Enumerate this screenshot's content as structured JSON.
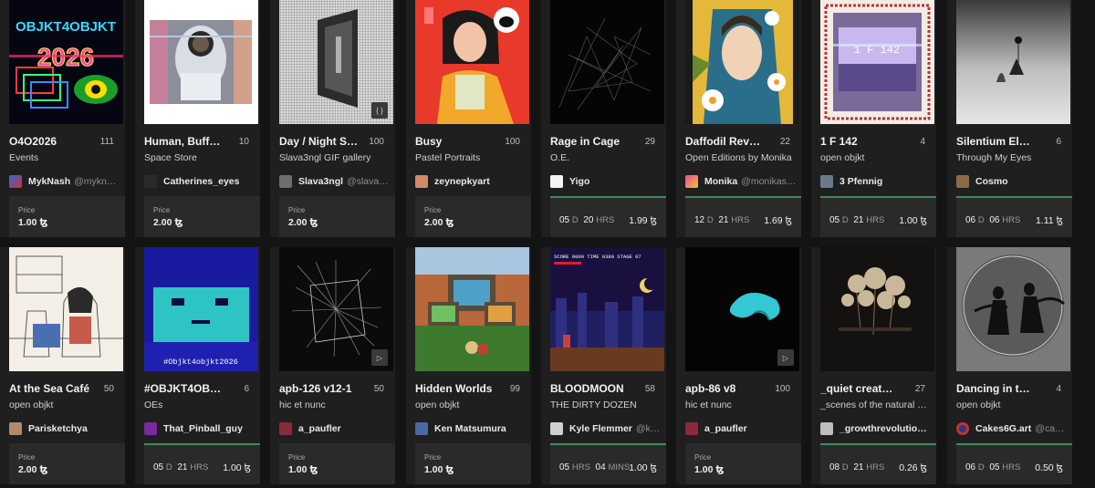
{
  "currency": "ꜩ",
  "price_label": "Price",
  "cards": [
    {
      "title": "O4O2026",
      "count": "111",
      "collection": "Events",
      "artist": "MykNash",
      "handle": "@myknash",
      "price": "1.00 ꜩ"
    },
    {
      "title": "Human, Buff…",
      "count": "10",
      "collection": "Space Store",
      "artist": "Catherines_eyes",
      "handle": "",
      "price": "2.00 ꜩ"
    },
    {
      "title": "Day / Night S…",
      "count": "100",
      "collection": "Slava3ngl GIF gallery",
      "artist": "Slava3ngl",
      "handle": "@slava3…",
      "price": "2.00 ꜩ",
      "thumb_button": "{ }"
    },
    {
      "title": "Busy",
      "count": "100",
      "collection": "Pastel Portraits",
      "artist": "zeynepkyart",
      "handle": "",
      "price": "2.00 ꜩ"
    },
    {
      "title": "Rage in Cage",
      "count": "29",
      "collection": "O.E.",
      "artist": "Yigo",
      "handle": "",
      "timer": {
        "a": "05",
        "au": "D",
        "b": "20",
        "bu": "HRS"
      },
      "price": "1.99 ꜩ"
    },
    {
      "title": "Daffodil Rev…",
      "count": "22",
      "collection": "Open Editions by Monika",
      "artist": "Monika",
      "handle": "@monikas…",
      "timer": {
        "a": "12",
        "au": "D",
        "b": "21",
        "bu": "HRS"
      },
      "price": "1.69 ꜩ"
    },
    {
      "title": "1 F 142",
      "count": "4",
      "collection": "open objkt",
      "artist": "3 Pfennig",
      "handle": "",
      "timer": {
        "a": "05",
        "au": "D",
        "b": "21",
        "bu": "HRS"
      },
      "price": "1.00 ꜩ"
    },
    {
      "title": "Silentium El…",
      "count": "6",
      "collection": "Through My Eyes",
      "artist": "Cosmo",
      "handle": "",
      "timer": {
        "a": "06",
        "au": "D",
        "b": "06",
        "bu": "HRS"
      },
      "price": "1.11 ꜩ"
    },
    {
      "title": "At the Sea Café",
      "count": "50",
      "collection": "open objkt",
      "artist": "Parisketchya",
      "handle": "",
      "price": "2.00 ꜩ"
    },
    {
      "title": "#OBJKT4OB…",
      "count": "6",
      "collection": "OEs",
      "artist": "That_Pinball_guy",
      "handle": "",
      "timer": {
        "a": "05",
        "au": "D",
        "b": "21",
        "bu": "HRS"
      },
      "price": "1.00 ꜩ"
    },
    {
      "title": "apb-126 v12-1",
      "count": "50",
      "collection": "hic et nunc",
      "artist": "a_paufler",
      "handle": "",
      "price": "1.00 ꜩ",
      "thumb_button": "▷"
    },
    {
      "title": "Hidden Worlds",
      "count": "99",
      "collection": "open objkt",
      "artist": "Ken Matsumura",
      "handle": "",
      "price": "1.00 ꜩ"
    },
    {
      "title": "BLOODMOON",
      "count": "58",
      "collection": "THE DIRTY DOZEN",
      "artist": "Kyle Flemmer",
      "handle": "@kf…",
      "timer": {
        "a": "05",
        "au": "HRS",
        "b": "04",
        "bu": "MINS"
      },
      "price": "1.00 ꜩ"
    },
    {
      "title": "apb-86 v8",
      "count": "100",
      "collection": "hic et nunc",
      "artist": "a_paufler",
      "handle": "",
      "price": "1.00 ꜩ",
      "thumb_button": "▷"
    },
    {
      "title": "_quiet creat…",
      "count": "27",
      "collection": "_scenes of the natural …",
      "artist": "_growthrevolutio…",
      "handle": "",
      "timer": {
        "a": "08",
        "au": "D",
        "b": "21",
        "bu": "HRS"
      },
      "price": "0.26 ꜩ"
    },
    {
      "title": "Dancing in t…",
      "count": "4",
      "collection": "open objkt",
      "artist": "Cakes6G.art",
      "handle": "@cak…",
      "timer": {
        "a": "06",
        "au": "D",
        "b": "05",
        "bu": "HRS"
      },
      "price": "0.50 ꜩ"
    }
  ],
  "thumb_text": {
    "c0_line1": "OBJKT4OBJKT",
    "c0_line2": "2026",
    "c6_text": "1 F 142",
    "c9_text": "#Objkt4objkt2026",
    "c12_text": "SCORE 0000 TIME 0380 STAGE 07"
  },
  "colors": {
    "card_bg": "#1f1f1f",
    "footer_bg": "#2a2a2a",
    "auction_border": "#3e8e57",
    "page_bg": "#141414"
  }
}
